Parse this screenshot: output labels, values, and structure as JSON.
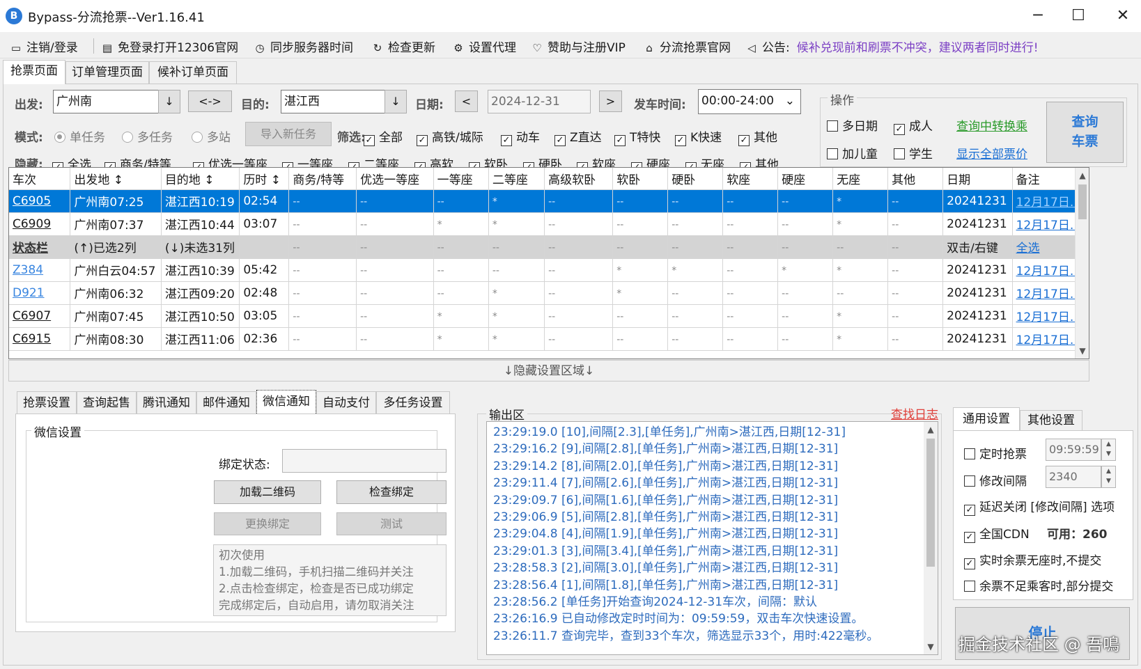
{
  "window": {
    "title": "Bypass-分流抢票--Ver1.16.41",
    "minimize": "─",
    "maximize": "☐",
    "close": "✕"
  },
  "toolbar": {
    "items": [
      {
        "label": "注销/登录",
        "icon": "monitor-icon"
      },
      {
        "label": "免登录打开12306官网",
        "icon": "browser-icon"
      },
      {
        "label": "同步服务器时间",
        "icon": "clock-icon"
      },
      {
        "label": "检查更新",
        "icon": "refresh-icon"
      },
      {
        "label": "设置代理",
        "icon": "gear-icon"
      },
      {
        "label": "赞助与注册VIP",
        "icon": "heart-icon"
      },
      {
        "label": "分流抢票官网",
        "icon": "home-icon"
      }
    ],
    "notice_label": "公告:",
    "notice_text": "候补兑现前和刷票不冲突，建议两者同时进行!"
  },
  "tabs": [
    "抢票页面",
    "订单管理页面",
    "候补订单页面"
  ],
  "search": {
    "from_label": "出发:",
    "from_value": "广州南",
    "swap": "<->",
    "to_label": "目的:",
    "to_value": "湛江西",
    "date_label": "日期:",
    "date_value": "2024-12-31",
    "prev": "<",
    "next": ">",
    "time_label": "发车时间:",
    "time_value": "00:00-24:00",
    "down_arrow": "↓",
    "chevron": "⌄"
  },
  "mode": {
    "label": "模式:",
    "options": [
      "单任务",
      "多任务",
      "多站"
    ],
    "import_button": "导入新任务"
  },
  "filter": {
    "label": "筛选:",
    "options": [
      "全部",
      "高铁/城际",
      "动车",
      "Z直达",
      "T特快",
      "K快速",
      "其他"
    ]
  },
  "hide": {
    "label": "隐藏:",
    "options": [
      "全选",
      "商务/特等",
      "优选一等座",
      "一等座",
      "二等座",
      "高软",
      "软卧",
      "硬卧",
      "软座",
      "硬座",
      "无座",
      "其他"
    ]
  },
  "operation": {
    "title": "操作",
    "multi_date": "多日期",
    "adult": "成人",
    "transfer_link": "查询中转换乘",
    "child": "加儿童",
    "student": "学生",
    "all_price_link": "显示全部票价",
    "query_button": [
      "查询",
      "车票"
    ]
  },
  "grid": {
    "headers": [
      "车次",
      "出发地 ↕",
      "目的地 ↕",
      "历时 ↕",
      "商务/特等",
      "优选一等座",
      "一等座",
      "二等座",
      "高级软卧",
      "软卧",
      "硬卧",
      "软座",
      "硬座",
      "无座",
      "其他",
      "日期",
      "备注"
    ],
    "rows": [
      {
        "type": "sel",
        "cells": [
          "C6905",
          "广州南07:25",
          "湛江西10:19",
          "02:54",
          "--",
          "--",
          "--",
          "*",
          "--",
          "--",
          "--",
          "--",
          "--",
          "*",
          "--",
          "20241231",
          "12月17日..."
        ]
      },
      {
        "type": "norm",
        "cells": [
          "C6909",
          "广州南07:37",
          "湛江西10:44",
          "03:07",
          "--",
          "--",
          "*",
          "*",
          "--",
          "--",
          "--",
          "--",
          "--",
          "*",
          "--",
          "20241231",
          "12月17日..."
        ]
      },
      {
        "type": "stat",
        "cells": [
          "状态栏",
          "(↑)已选2列",
          "(↓)未选31列",
          "",
          "--",
          "--",
          "--",
          "--",
          "--",
          "--",
          "--",
          "--",
          "--",
          "--",
          "--",
          "双击/右键",
          "全选"
        ]
      },
      {
        "type": "norm",
        "cells": [
          "Z384",
          "广州白云04:57",
          "湛江西10:39",
          "05:42",
          "--",
          "--",
          "--",
          "--",
          "--",
          "*",
          "*",
          "--",
          "*",
          "*",
          "--",
          "20241231",
          "12月17日..."
        ]
      },
      {
        "type": "norm",
        "cells": [
          "D921",
          "广州南06:32",
          "湛江西09:20",
          "02:48",
          "--",
          "--",
          "--",
          "*",
          "--",
          "*",
          "--",
          "--",
          "--",
          "--",
          "--",
          "20241231",
          "12月17日..."
        ]
      },
      {
        "type": "norm",
        "cells": [
          "C6907",
          "广州南07:45",
          "湛江西10:50",
          "03:05",
          "--",
          "--",
          "*",
          "*",
          "--",
          "--",
          "--",
          "--",
          "--",
          "*",
          "--",
          "20241231",
          "12月17日..."
        ]
      },
      {
        "type": "norm",
        "cells": [
          "C6915",
          "广州南08:30",
          "湛江西11:06",
          "02:36",
          "--",
          "--",
          "*",
          "*",
          "--",
          "--",
          "--",
          "--",
          "--",
          "*",
          "--",
          "20241231",
          "12月17日..."
        ]
      }
    ]
  },
  "hide_area": "↓隐藏设置区域↓",
  "left_tabs": [
    "抢票设置",
    "查询起售",
    "腾讯通知",
    "邮件通知",
    "微信通知",
    "自动支付",
    "多任务设置"
  ],
  "wechat": {
    "group_title": "微信设置",
    "bind_status_label": "绑定状态:",
    "bind_status_value": "",
    "load_qr": "加载二维码",
    "check_bind": "检查绑定",
    "change_bind": "更换绑定",
    "test": "测试",
    "help": [
      "初次使用",
      "1.加载二维码，手机扫描二维码并关注",
      "2.点击检查绑定，检查是否已成功绑定",
      "完成绑定后，自动启用，请勿取消关注"
    ]
  },
  "output": {
    "title": "输出区",
    "log_link": "查找日志",
    "lines": [
      "23:29:19.0  [10],间隔[2.3],[单任务],广州南>湛江西,日期[12-31]",
      "23:29:16.2  [9],间隔[2.8],[单任务],广州南>湛江西,日期[12-31]",
      "23:29:14.2  [8],间隔[2.0],[单任务],广州南>湛江西,日期[12-31]",
      "23:29:11.4  [7],间隔[2.6],[单任务],广州南>湛江西,日期[12-31]",
      "23:29:09.7  [6],间隔[1.6],[单任务],广州南>湛江西,日期[12-31]",
      "23:29:06.9  [5],间隔[2.8],[单任务],广州南>湛江西,日期[12-31]",
      "23:29:04.8  [4],间隔[1.9],[单任务],广州南>湛江西,日期[12-31]",
      "23:29:01.3  [3],间隔[3.4],[单任务],广州南>湛江西,日期[12-31]",
      "23:28:58.3  [2],间隔[3.0],[单任务],广州南>湛江西,日期[12-31]",
      "23:28:56.4  [1],间隔[1.8],[单任务],广州南>湛江西,日期[12-31]",
      "23:28:56.2  [单任务]开始查询2024-12-31车次，间隔：默认",
      "23:26:16.9  已自动修改定时时间为：09:59:59，双击车次快速设置。",
      "23:26:11.7  查询完毕，查到33个车次，筛选显示33个，用时:422毫秒。"
    ]
  },
  "settings": {
    "tabs": [
      "通用设置",
      "其他设置"
    ],
    "timer_label": "定时抢票",
    "timer_value": "09:59:59",
    "interval_label": "修改间隔",
    "interval_value": "2340",
    "delay_close": "延迟关闭 [修改间隔] 选项",
    "cdn_label": "全国CDN",
    "cdn_avail": "可用：260",
    "no_seat": "实时余票无座时,不提交",
    "partial": "余票不足乘客时,部分提交",
    "stop_button": "停止"
  },
  "watermark": "掘金技术社区 @ 吾鳴",
  "colors": {
    "selection": "#0078d7",
    "link": "#1a6fd4",
    "notice": "#7b3fc4",
    "log": "#2d6bbd",
    "red_link": "#e0403a",
    "green_link": "#2a9a2a"
  }
}
